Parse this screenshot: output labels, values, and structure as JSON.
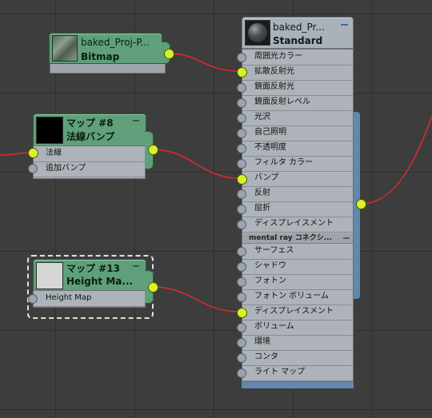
{
  "nodes": {
    "bitmap": {
      "title": "baked_Proj-P...",
      "subtitle": "Bitmap"
    },
    "normal_bump": {
      "title": "マップ #8",
      "subtitle": "法線バンプ",
      "slots": [
        "法線",
        "追加バンプ"
      ]
    },
    "height_map": {
      "title": "マップ #13",
      "subtitle": "Height Ma...",
      "slots": [
        "Height Map"
      ]
    },
    "material": {
      "title": "baked_Pr...",
      "subtitle": "Standard",
      "slots": [
        "周囲光カラー",
        "拡散反射光",
        "鏡面反射光",
        "鏡面反射レベル",
        "光沢",
        "自己照明",
        "不透明度",
        "フィルタ カラー",
        "バンプ",
        "反射",
        "屈折",
        "ディスプレイスメント"
      ],
      "section_label": "mental ray コネクシ...",
      "mr_slots": [
        "サーフェス",
        "シャドウ",
        "フォトン",
        "フォトン ボリューム",
        "ディスプレイスメント",
        "ボリューム",
        "環境",
        "コンタ",
        "ライト マップ"
      ]
    }
  },
  "colors": {
    "canvas": "#3d3d3d",
    "map_header": "#5fa07a",
    "material_accent": "#6288b0",
    "wire": "#e02a2a",
    "socket_connected": "#d8f22a",
    "selection_dashes": "#e0e0e0"
  }
}
